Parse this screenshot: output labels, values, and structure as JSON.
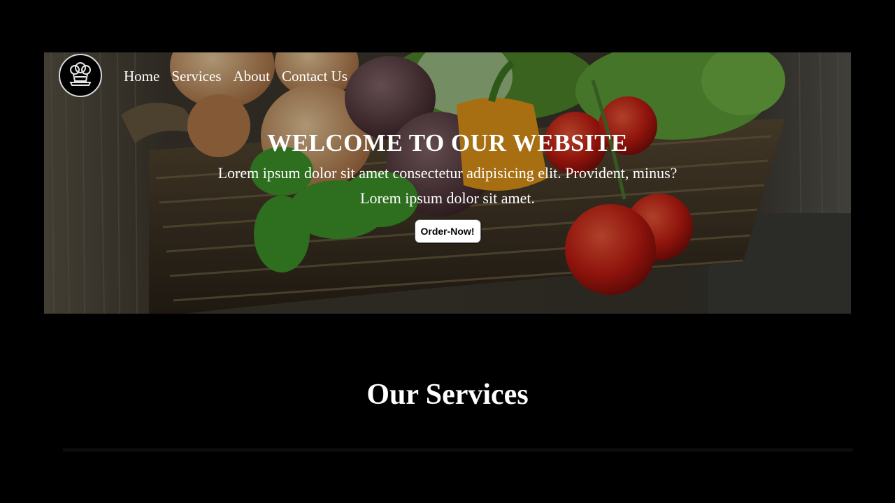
{
  "logo": {
    "icon": "chef-hat-icon"
  },
  "nav": {
    "items": [
      {
        "label": "Home"
      },
      {
        "label": "Services"
      },
      {
        "label": "About"
      },
      {
        "label": "Contact Us"
      }
    ]
  },
  "hero": {
    "title": "WELCOME TO OUR WEBSITE",
    "text": "Lorem ipsum dolor sit amet consectetur adipisicing elit. Provident, minus? Lorem ipsum dolor sit amet.",
    "button_label": "Order-Now!",
    "background": "vegetable basket photo"
  },
  "services": {
    "heading": "Our Services"
  },
  "colors": {
    "page_background": "#000000",
    "text": "#ffffff",
    "button_background": "#ffffff"
  }
}
